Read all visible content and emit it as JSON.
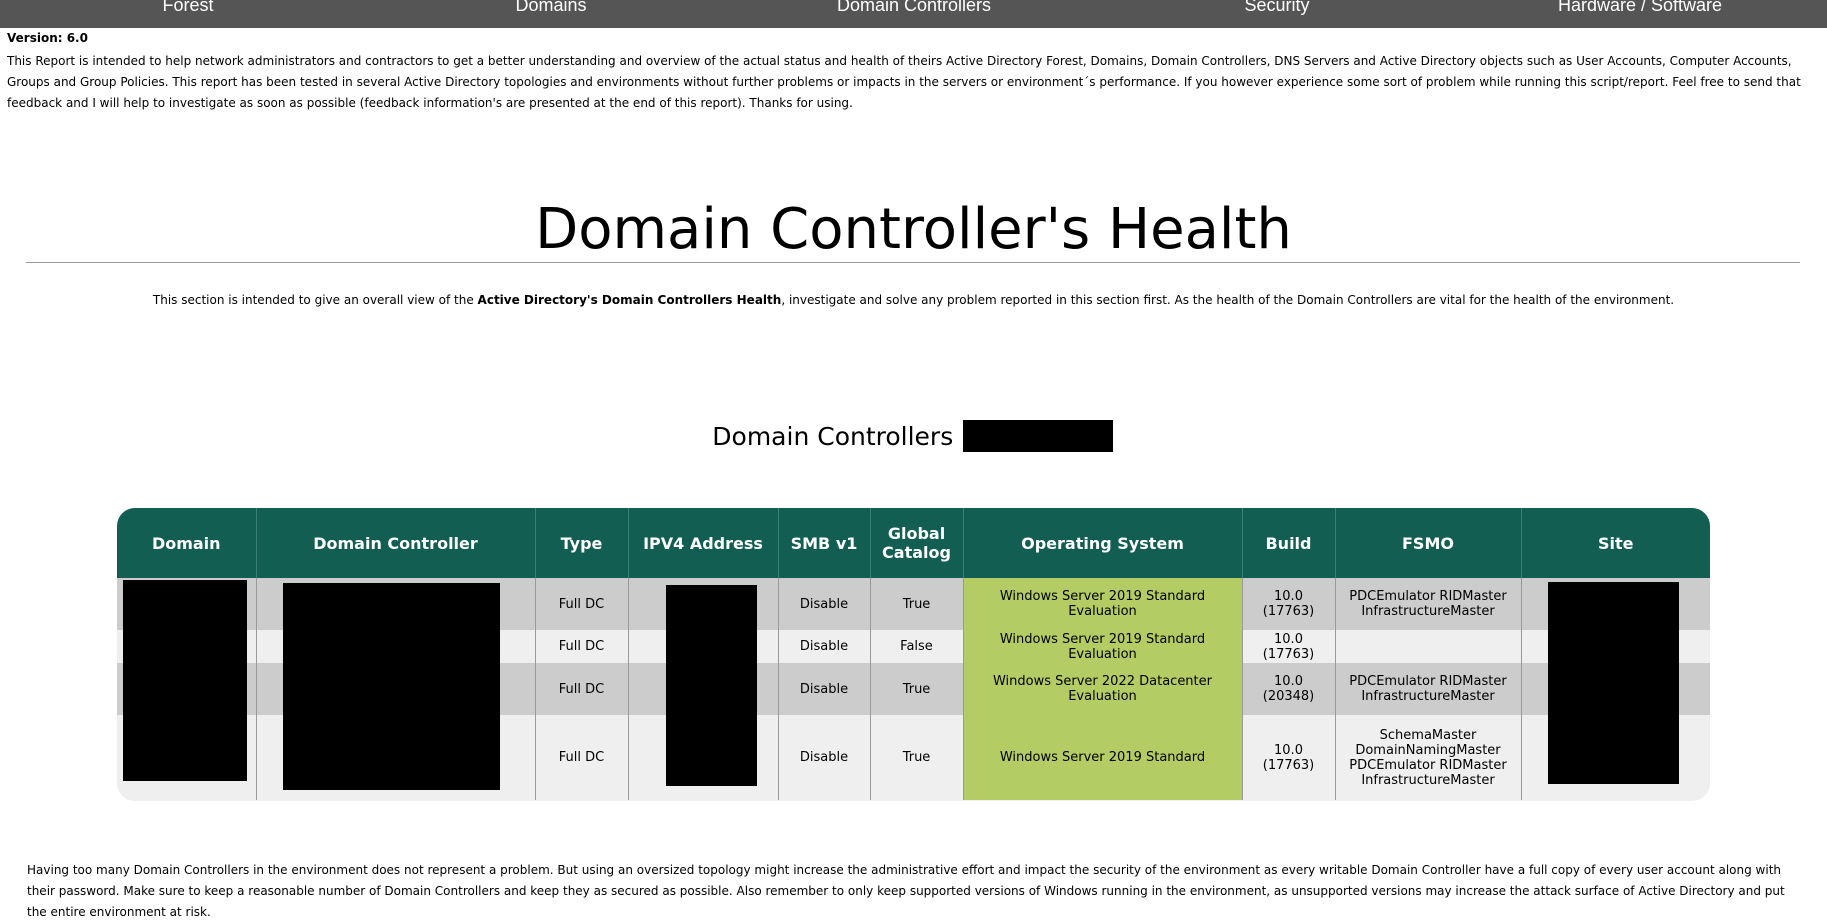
{
  "nav": [
    "Forest",
    "Domains",
    "Domain Controllers",
    "Security",
    "Hardware / Software"
  ],
  "version": "Version: 6.0",
  "intro": "This Report is intended to help network administrators and contractors to get a better understanding and overview of the actual status and health of theirs Active Directory Forest, Domains, Domain Controllers, DNS Servers and Active Directory objects such as User Accounts, Computer Accounts, Groups and Group Policies. This report has been tested in several Active Directory topologies and environments without further problems or impacts in the servers or environment´s performance. If you however experience some sort of problem while running this script/report. Feel free to send that feedback and I will help to investigate as soon as possible (feedback information's are presented at the end of this report). Thanks for using.",
  "section_title": "Domain Controller's Health",
  "section_desc": {
    "prefix": "This section is intended to give an overall view of the ",
    "bold": "Active Directory's Domain Controllers Health",
    "suffix": ", investigate and solve any problem reported in this section first. As the health of the Domain Controllers are vital for the health of the environment."
  },
  "table_title": {
    "prefix": "Domain Controllers (",
    "suffix": ")"
  },
  "table": {
    "headers": [
      "Domain",
      "Domain Controller",
      "Type",
      "IPV4 Address",
      "SMB v1",
      "Global Catalog",
      "Operating System",
      "Build",
      "FSMO",
      "Site"
    ],
    "rows": [
      {
        "type": "Full DC",
        "smb": "Disable",
        "gc": "True",
        "os": "Windows Server 2019 Standard Evaluation",
        "build": "10.0 (17763)",
        "fsmo": [
          "PDCEmulator RIDMaster",
          "InfrastructureMaster"
        ]
      },
      {
        "type": "Full DC",
        "smb": "Disable",
        "gc": "False",
        "os": "Windows Server 2019 Standard Evaluation",
        "build": "10.0 (17763)",
        "fsmo": []
      },
      {
        "type": "Full DC",
        "smb": "Disable",
        "gc": "True",
        "os": "Windows Server 2022 Datacenter Evaluation",
        "build": "10.0 (20348)",
        "fsmo": [
          "PDCEmulator RIDMaster",
          "InfrastructureMaster"
        ]
      },
      {
        "type": "Full DC",
        "smb": "Disable",
        "gc": "True",
        "os": "Windows Server 2019 Standard",
        "build": "10.0 (17763)",
        "fsmo": [
          "SchemaMaster",
          "DomainNamingMaster",
          "PDCEmulator RIDMaster",
          "InfrastructureMaster"
        ]
      }
    ]
  },
  "footer": "Having too many Domain Controllers in the environment does not represent a problem. But using an oversized topology might increase the administrative effort and impact the security of the environment as every writable Domain Controller have a full copy of every user account along with their password. Make sure to keep a reasonable number of Domain Controllers and keep they as secured as possible. Also remember to only keep supported versions of Windows running in the environment, as unsupported versions may increase the attack surface of Active Directory and put the entire environment at risk.",
  "colors": {
    "nav_bg": "#555555",
    "header_bg": "#135e52",
    "os_ok": "#b3cc63",
    "row_dark": "#cccccc",
    "row_light": "#efefef"
  }
}
